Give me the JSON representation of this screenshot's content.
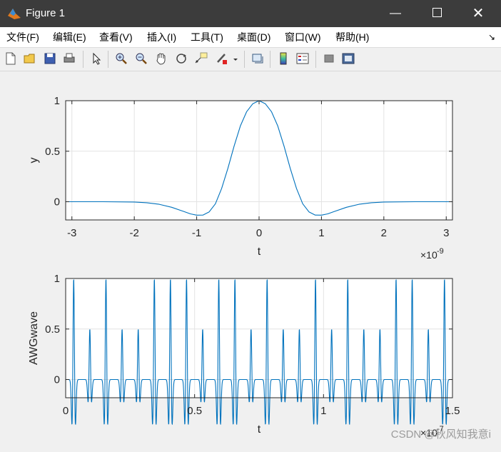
{
  "window": {
    "title": "Figure 1",
    "minimize_glyph": "—",
    "close_glyph": "✕"
  },
  "menu": [
    {
      "label": "文件(F)"
    },
    {
      "label": "编辑(E)"
    },
    {
      "label": "查看(V)"
    },
    {
      "label": "插入(I)"
    },
    {
      "label": "工具(T)"
    },
    {
      "label": "桌面(D)"
    },
    {
      "label": "窗口(W)"
    },
    {
      "label": "帮助(H)"
    }
  ],
  "menu_overflow_glyph": "↘",
  "toolbar": [
    {
      "name": "new-figure-icon"
    },
    {
      "name": "open-file-icon"
    },
    {
      "name": "save-icon"
    },
    {
      "name": "print-icon"
    },
    {
      "name": "edit-plot-arrow-icon"
    },
    {
      "name": "zoom-in-icon"
    },
    {
      "name": "zoom-out-icon"
    },
    {
      "name": "pan-hand-icon"
    },
    {
      "name": "rotate-3d-icon"
    },
    {
      "name": "data-cursor-icon"
    },
    {
      "name": "brush-icon"
    },
    {
      "name": "brush-dropdown-icon"
    },
    {
      "name": "link-plot-icon"
    },
    {
      "name": "insert-colorbar-icon"
    },
    {
      "name": "insert-legend-icon"
    },
    {
      "name": "hide-plot-tools-icon"
    },
    {
      "name": "show-plot-tools-icon"
    }
  ],
  "chart_data": [
    {
      "type": "line",
      "xlabel": "t",
      "ylabel": "y",
      "x_exponent_label": "×10",
      "x_exponent_power": "-9",
      "xlim": [
        -3.1,
        3.1
      ],
      "ylim": [
        -0.18,
        1.0
      ],
      "xticks": [
        -3,
        -2,
        -1,
        0,
        1,
        2,
        3
      ],
      "xtick_labels": [
        "-3",
        "-2",
        "-1",
        "0",
        "1",
        "2",
        "3"
      ],
      "yticks": [
        0,
        0.5,
        1
      ],
      "ytick_labels": [
        "0",
        "0.5",
        "1"
      ],
      "grid": true,
      "line_color": "#0072bd",
      "x": [
        -3.1,
        -2.5,
        -2.0,
        -1.8,
        -1.6,
        -1.4,
        -1.2,
        -1.1,
        -1.0,
        -0.9,
        -0.8,
        -0.7,
        -0.6,
        -0.5,
        -0.4,
        -0.3,
        -0.2,
        -0.1,
        0,
        0.1,
        0.2,
        0.3,
        0.4,
        0.5,
        0.6,
        0.7,
        0.8,
        0.9,
        1.0,
        1.1,
        1.2,
        1.4,
        1.6,
        1.8,
        2.0,
        2.5,
        3.1
      ],
      "y": [
        0,
        0,
        -0.003,
        -0.01,
        -0.025,
        -0.055,
        -0.098,
        -0.12,
        -0.133,
        -0.132,
        -0.1,
        -0.02,
        0.13,
        0.33,
        0.55,
        0.75,
        0.89,
        0.97,
        1.0,
        0.97,
        0.89,
        0.75,
        0.55,
        0.33,
        0.13,
        -0.02,
        -0.1,
        -0.132,
        -0.133,
        -0.12,
        -0.098,
        -0.055,
        -0.025,
        -0.01,
        -0.003,
        0,
        0
      ]
    },
    {
      "type": "line",
      "xlabel": "t",
      "ylabel": "AWGwave",
      "x_exponent_label": "×10",
      "x_exponent_power": "-7",
      "xlim": [
        0,
        1.5
      ],
      "ylim": [
        -0.18,
        1.0
      ],
      "xticks": [
        0,
        0.5,
        1,
        1.5
      ],
      "xtick_labels": [
        "0",
        "0.5",
        "1",
        "1.5"
      ],
      "yticks": [
        0,
        0.5,
        1
      ],
      "ytick_labels": [
        "0",
        "0.5",
        "1"
      ],
      "grid": true,
      "line_color": "#0072bd",
      "pulse_width": 0.0039,
      "pulses": [
        {
          "t": 0.0313,
          "a": 1.0
        },
        {
          "t": 0.0938,
          "a": 0.5
        },
        {
          "t": 0.1563,
          "a": 1.0
        },
        {
          "t": 0.2188,
          "a": 0.5
        },
        {
          "t": 0.2813,
          "a": 0.5
        },
        {
          "t": 0.3438,
          "a": 1.0
        },
        {
          "t": 0.4063,
          "a": 1.0
        },
        {
          "t": 0.4688,
          "a": 1.0
        },
        {
          "t": 0.5313,
          "a": 0.5
        },
        {
          "t": 0.5938,
          "a": 1.0
        },
        {
          "t": 0.6563,
          "a": 1.0
        },
        {
          "t": 0.7188,
          "a": 0.5
        },
        {
          "t": 0.7813,
          "a": 1.0
        },
        {
          "t": 0.8438,
          "a": 0.5
        },
        {
          "t": 0.9063,
          "a": 0.5
        },
        {
          "t": 0.9688,
          "a": 1.0
        },
        {
          "t": 1.0313,
          "a": 0.5
        },
        {
          "t": 1.0938,
          "a": 1.0
        },
        {
          "t": 1.1563,
          "a": 0.5
        },
        {
          "t": 1.2188,
          "a": 0.5
        },
        {
          "t": 1.2813,
          "a": 1.0
        },
        {
          "t": 1.3438,
          "a": 1.0
        },
        {
          "t": 1.4063,
          "a": 0.5
        },
        {
          "t": 1.4688,
          "a": 1.0
        }
      ]
    }
  ],
  "watermark": "CSDN @秋风知我意i"
}
